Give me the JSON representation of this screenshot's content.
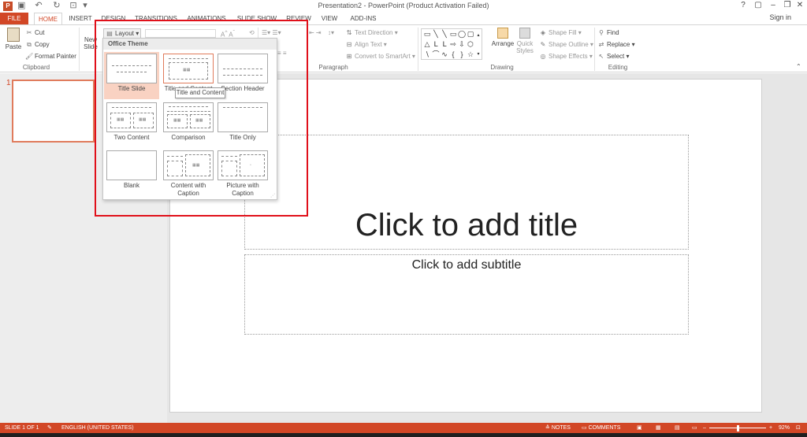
{
  "window": {
    "title": "Presentation2 - PowerPoint (Product Activation Failed)",
    "app_icon_letter": "P",
    "controls": [
      "?",
      "▢",
      "–",
      "❐",
      "✕"
    ]
  },
  "qat": {
    "undo": "↶",
    "redo": "↻",
    "customize": "▾"
  },
  "tabs": [
    "FILE",
    "HOME",
    "INSERT",
    "DESIGN",
    "TRANSITIONS",
    "ANIMATIONS",
    "SLIDE SHOW",
    "REVIEW",
    "VIEW",
    "ADD-INS"
  ],
  "sign_in": "Sign in",
  "ribbon": {
    "clipboard": {
      "paste": "Paste",
      "cut": "Cut",
      "copy": "Copy",
      "format_painter": "Format Painter",
      "label": "Clipboard"
    },
    "slides": {
      "new_slide": "New",
      "new_slide_2": "Slide",
      "layout": "Layout"
    },
    "paragraph": {
      "text_direction": "Text Direction",
      "align_text": "Align Text",
      "convert_smartart": "Convert to SmartArt",
      "label": "Paragraph"
    },
    "drawing": {
      "arrange": "Arrange",
      "quick": "Quick",
      "styles": "Styles",
      "shape_fill": "Shape Fill",
      "shape_outline": "Shape Outline",
      "shape_effects": "Shape Effects",
      "label": "Drawing"
    },
    "editing": {
      "find": "Find",
      "replace": "Replace",
      "select": "Select",
      "label": "Editing"
    }
  },
  "layout_dropdown": {
    "header": "Office Theme",
    "items": [
      "Title Slide",
      "Title and Content",
      "Section Header",
      "Two Content",
      "Comparison",
      "Title Only",
      "Blank",
      "Content with",
      "Caption",
      "Picture with"
    ],
    "tooltip": "Title and Content"
  },
  "slide": {
    "number": "1",
    "title_placeholder": "Click to add title",
    "subtitle_placeholder": "Click to add subtitle"
  },
  "status": {
    "slide_of": "SLIDE 1 OF 1",
    "language": "ENGLISH (UNITED STATES)",
    "notes": "NOTES",
    "comments": "COMMENTS",
    "zoom": "92%",
    "zoom_level_fraction": 0.5
  },
  "colors": {
    "accent": "#d24726",
    "highlight": "#e0101a"
  }
}
